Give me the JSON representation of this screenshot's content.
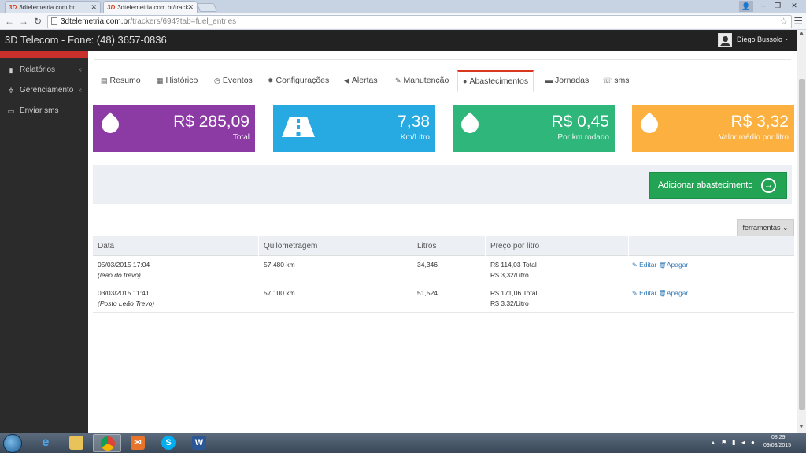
{
  "browser": {
    "tabs": [
      {
        "favicon": "3D",
        "title": "3dtelemetria.com.br",
        "active": false
      },
      {
        "favicon": "3D",
        "title": "3dtelemetria.com.br/track",
        "active": true
      }
    ],
    "url_host": "3dtelemetria.com.br",
    "url_path": "/trackers/694?tab=fuel_entries",
    "icons": {
      "back": "back-arrow-icon",
      "forward": "forward-arrow-icon",
      "reload": "reload-icon",
      "bookmark": "star-icon",
      "menu": "hamburger-menu-icon"
    }
  },
  "header": {
    "brand": "3D Telecom - Fone: (48) 3657-0836",
    "user_name": "Diego Bussolo",
    "user_caret": "⌄"
  },
  "sidebar": {
    "items": [
      {
        "label": "Relatórios",
        "icon": "book-icon",
        "has_chevron": true
      },
      {
        "label": "Gerenciamento",
        "icon": "gears-icon",
        "has_chevron": true
      },
      {
        "label": "Enviar sms",
        "icon": "chat-icon",
        "has_chevron": false
      }
    ],
    "chevron": "‹"
  },
  "tabs": [
    {
      "label": "Resumo",
      "icon": "▤"
    },
    {
      "label": "Histórico",
      "icon": "▦"
    },
    {
      "label": "Eventos",
      "icon": "◷"
    },
    {
      "label": "Configurações",
      "icon": "✹"
    },
    {
      "label": "Alertas",
      "icon": "◀"
    },
    {
      "label": "Manutenção",
      "icon": "✎"
    },
    {
      "label": "Abastecimentos",
      "icon": "●"
    },
    {
      "label": "Jornadas",
      "icon": "▬"
    },
    {
      "label": "sms",
      "icon": "☏"
    }
  ],
  "active_tab": "Abastecimentos",
  "stats": [
    {
      "value": "R$ 285,09",
      "label": "Total",
      "color": "#8c3ba4",
      "icon": "drop-icon"
    },
    {
      "value": "7,38",
      "label": "Km/Litro",
      "color": "#27a9e1",
      "icon": "road-icon"
    },
    {
      "value": "R$ 0,45",
      "label": "Por km rodado",
      "color": "#2fb67a",
      "icon": "drop-icon"
    },
    {
      "value": "R$ 3,32",
      "label": "Valor médio por litro",
      "color": "#fbb040",
      "icon": "drop-icon"
    }
  ],
  "actions": {
    "add_label": "Adicionar abastecimento",
    "add_icon": "→",
    "tools_label": "ferramentas ⌄"
  },
  "table": {
    "columns": [
      "Data",
      "Quilometragem",
      "Litros",
      "Preço por litro",
      ""
    ],
    "rows": [
      {
        "date": "05/03/2015 17:04",
        "note": "(leao do trevo)",
        "km": "57.480 km",
        "liters": "34,346",
        "total": "R$ 114,03 Total",
        "per_liter": "R$ 3,32/Litro"
      },
      {
        "date": "03/03/2015 11:41",
        "note": "(Posto Leão Trevo)",
        "km": "57.100 km",
        "liters": "51,524",
        "total": "R$ 171,06 Total",
        "per_liter": "R$ 3,32/Litro"
      }
    ],
    "edit_label": "Editar",
    "delete_label": "Apagar",
    "edit_icon": "✎",
    "delete_icon": "🗑"
  },
  "taskbar": {
    "apps": [
      "internet-explorer",
      "file-explorer",
      "chrome",
      "email",
      "skype",
      "word"
    ],
    "clock_time": "08:29",
    "clock_date": "09/03/2015"
  }
}
